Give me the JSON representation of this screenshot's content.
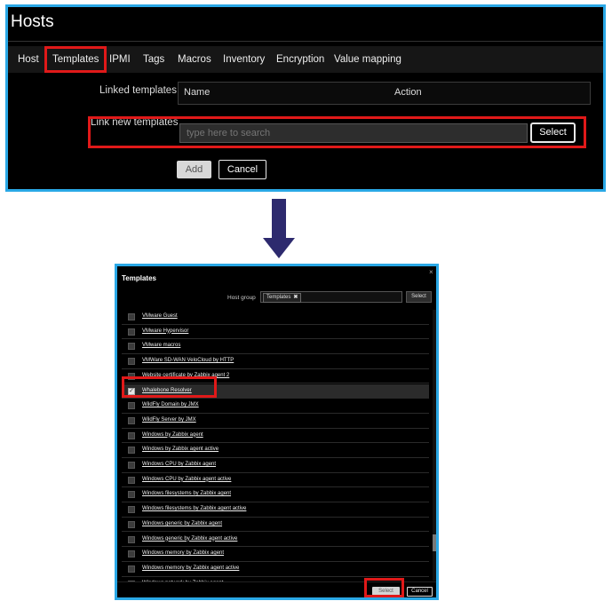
{
  "hosts_panel": {
    "title": "Hosts",
    "tabs": [
      {
        "label": "Host",
        "active": false
      },
      {
        "label": "Templates",
        "active": true
      },
      {
        "label": "IPMI",
        "active": false
      },
      {
        "label": "Tags",
        "active": false
      },
      {
        "label": "Macros",
        "active": false
      },
      {
        "label": "Inventory",
        "active": false
      },
      {
        "label": "Encryption",
        "active": false
      },
      {
        "label": "Value mapping",
        "active": false
      }
    ],
    "linked_templates_label": "Linked templates",
    "linked_columns": {
      "name": "Name",
      "action": "Action"
    },
    "link_new_label": "Link new templates",
    "search_placeholder": "type here to search",
    "select_button": "Select",
    "add_button": "Add",
    "cancel_button": "Cancel"
  },
  "templates_modal": {
    "title": "Templates",
    "close_glyph": "×",
    "host_group_label": "Host group",
    "host_group_chip": "Templates",
    "chip_remove_glyph": "✖",
    "host_group_select": "Select",
    "items": [
      {
        "label": "VMware Guest",
        "checked": false
      },
      {
        "label": "VMware Hypervisor",
        "checked": false
      },
      {
        "label": "VMware macros",
        "checked": false
      },
      {
        "label": "VMWare SD-WAN VeloCloud by HTTP",
        "checked": false
      },
      {
        "label": "Website certificate by Zabbix agent 2",
        "checked": false
      },
      {
        "label": "Whalebone Resolver",
        "checked": true
      },
      {
        "label": "WildFly Domain by JMX",
        "checked": false
      },
      {
        "label": "WildFly Server by JMX",
        "checked": false
      },
      {
        "label": "Windows by Zabbix agent",
        "checked": false
      },
      {
        "label": "Windows by Zabbix agent active",
        "checked": false
      },
      {
        "label": "Windows CPU by Zabbix agent",
        "checked": false
      },
      {
        "label": "Windows CPU by Zabbix agent active",
        "checked": false
      },
      {
        "label": "Windows filesystems by Zabbix agent",
        "checked": false
      },
      {
        "label": "Windows filesystems by Zabbix agent active",
        "checked": false
      },
      {
        "label": "Windows generic by Zabbix agent",
        "checked": false
      },
      {
        "label": "Windows generic by Zabbix agent active",
        "checked": false
      },
      {
        "label": "Windows memory by Zabbix agent",
        "checked": false
      },
      {
        "label": "Windows memory by Zabbix agent active",
        "checked": false
      },
      {
        "label": "Windows network by Zabbix agent",
        "checked": false
      }
    ],
    "select_button": "Select",
    "cancel_button": "Cancel"
  },
  "colors": {
    "panel_border": "#2aa8e6",
    "highlight": "#e01919",
    "arrow": "#2d2a6e",
    "background": "#000000"
  }
}
